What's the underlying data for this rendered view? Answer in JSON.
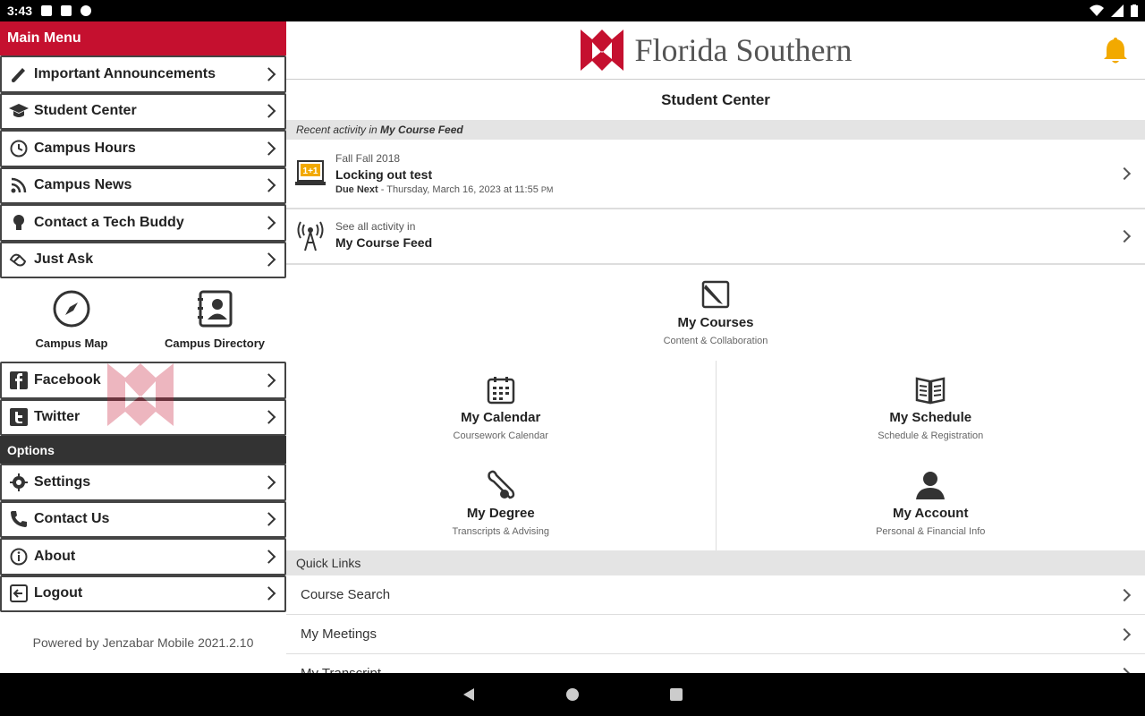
{
  "status_bar": {
    "time": "3:43"
  },
  "sidebar": {
    "header": "Main Menu",
    "items": [
      {
        "label": "Important Announcements",
        "icon": "megaphone-icon"
      },
      {
        "label": "Student Center",
        "icon": "graduation-cap-icon"
      },
      {
        "label": "Campus Hours",
        "icon": "clock-icon"
      },
      {
        "label": "Campus News",
        "icon": "rss-icon"
      },
      {
        "label": "Contact a Tech Buddy",
        "icon": "lightbulb-icon"
      },
      {
        "label": "Just Ask",
        "icon": "handshake-icon"
      }
    ],
    "tiles": [
      {
        "label": "Campus Map",
        "icon": "compass-icon"
      },
      {
        "label": "Campus Directory",
        "icon": "address-book-icon"
      }
    ],
    "social": [
      {
        "label": "Facebook",
        "icon": "facebook-icon"
      },
      {
        "label": "Twitter",
        "icon": "twitter-icon"
      }
    ],
    "options_header": "Options",
    "options": [
      {
        "label": "Settings",
        "icon": "gear-icon"
      },
      {
        "label": "Contact Us",
        "icon": "phone-icon"
      },
      {
        "label": "About",
        "icon": "info-icon"
      },
      {
        "label": "Logout",
        "icon": "logout-icon"
      }
    ],
    "powered_by": "Powered by Jenzabar Mobile 2021.2.10"
  },
  "header": {
    "logo_text": "Florida Southern",
    "page_title": "Student Center"
  },
  "feed": {
    "header_prefix": "Recent activity in",
    "header_feed": "My Course Feed",
    "item": {
      "term": "Fall Fall 2018",
      "title": "Locking out test",
      "due_label": "Due Next",
      "due_text": "- Thursday, March 16, 2023 at 11:55",
      "due_ampm": "PM"
    },
    "see_all_label": "See all activity in",
    "see_all_target": "My Course Feed"
  },
  "grid": {
    "courses": {
      "title": "My Courses",
      "sub": "Content & Collaboration"
    },
    "calendar": {
      "title": "My Calendar",
      "sub": "Coursework Calendar"
    },
    "schedule": {
      "title": "My Schedule",
      "sub": "Schedule & Registration"
    },
    "degree": {
      "title": "My Degree",
      "sub": "Transcripts & Advising"
    },
    "account": {
      "title": "My Account",
      "sub": "Personal & Financial Info"
    }
  },
  "quick_links": {
    "header": "Quick Links",
    "items": [
      "Course Search",
      "My Meetings",
      "My Transcript"
    ]
  },
  "colors": {
    "brand_red": "#c5102f",
    "bell": "#f2a900"
  }
}
